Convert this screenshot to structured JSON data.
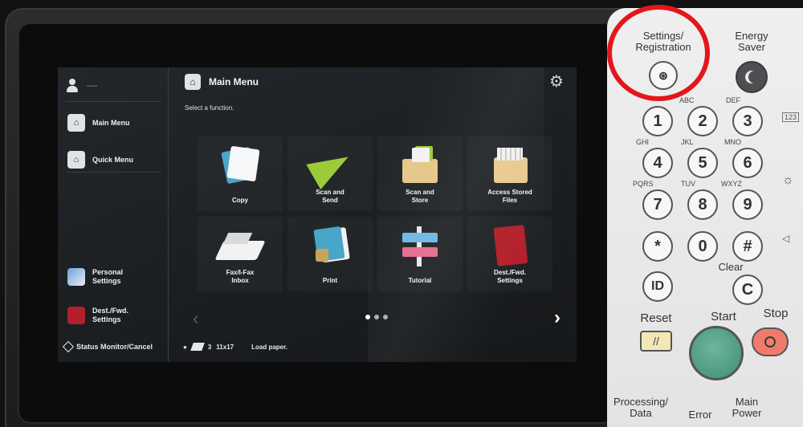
{
  "screen": {
    "user_name": "----",
    "header_title": "Main Menu",
    "subtitle": "Select a function.",
    "rail": {
      "main_menu": "Main Menu",
      "quick_menu": "Quick Menu",
      "personal_settings": "Personal Settings",
      "dest_fwd_settings": "Dest./Fwd. Settings",
      "status_monitor": "Status Monitor/Cancel"
    },
    "tiles": [
      {
        "label": "Copy"
      },
      {
        "label": "Scan and Send"
      },
      {
        "label": "Scan and Store"
      },
      {
        "label": "Access Stored Files"
      },
      {
        "label": "Fax/I-Fax Inbox"
      },
      {
        "label": "Print"
      },
      {
        "label": "Tutorial"
      },
      {
        "label": "Dest./Fwd. Settings"
      }
    ],
    "status_bar": {
      "paper_count": "3",
      "paper_size": "11x17",
      "message": "Load paper."
    },
    "pager_pages": 3,
    "pager_active": 1
  },
  "panel": {
    "settings_registration": "Settings/\nRegistration",
    "energy_saver": "Energy\nSaver",
    "keys": [
      {
        "digit": "1",
        "letters": ""
      },
      {
        "digit": "2",
        "letters": "ABC"
      },
      {
        "digit": "3",
        "letters": "DEF"
      },
      {
        "digit": "4",
        "letters": "GHI"
      },
      {
        "digit": "5",
        "letters": "JKL"
      },
      {
        "digit": "6",
        "letters": "MNO"
      },
      {
        "digit": "7",
        "letters": "PQRS"
      },
      {
        "digit": "8",
        "letters": "TUV"
      },
      {
        "digit": "9",
        "letters": "WXYZ"
      },
      {
        "digit": "*",
        "letters": ""
      },
      {
        "digit": "0",
        "letters": ""
      },
      {
        "digit": "#",
        "letters": ""
      }
    ],
    "id_key": "ID",
    "clear_label": "Clear",
    "clear_key": "C",
    "reset_label": "Reset",
    "start_label": "Start",
    "stop_label": "Stop",
    "processing_data": "Processing/\nData",
    "error_label": "Error",
    "main_power": "Main\nPower",
    "display_mode_badge": "123"
  },
  "accent_colors": {
    "highlight_ring": "#e3161c",
    "start_button": "#4e9f84",
    "stop_button": "#f07b6c",
    "reset_button": "#f3e7b5"
  }
}
